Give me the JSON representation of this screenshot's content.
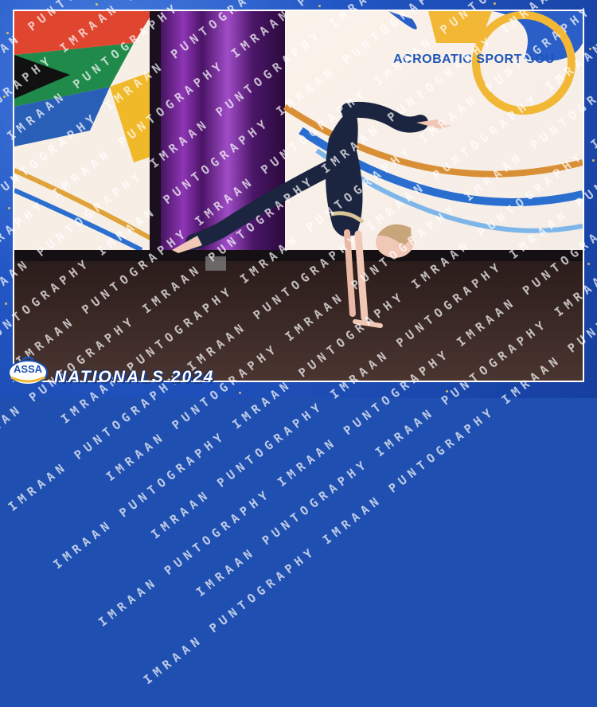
{
  "photo": {
    "banner_text": "ACROBATIC SPORT SOU",
    "watermark_text": "IMRAAN PUNTOGRAPHY",
    "logo_text": "ASSA",
    "event_title": "NATIONALS 2024"
  },
  "colors": {
    "frame_blue": "#2256c4",
    "banner_blue": "#1f57b8",
    "curtain_purple": "#7a2a9e",
    "floor_brown": "#3b2a26",
    "leotard_navy": "#1c2540"
  }
}
